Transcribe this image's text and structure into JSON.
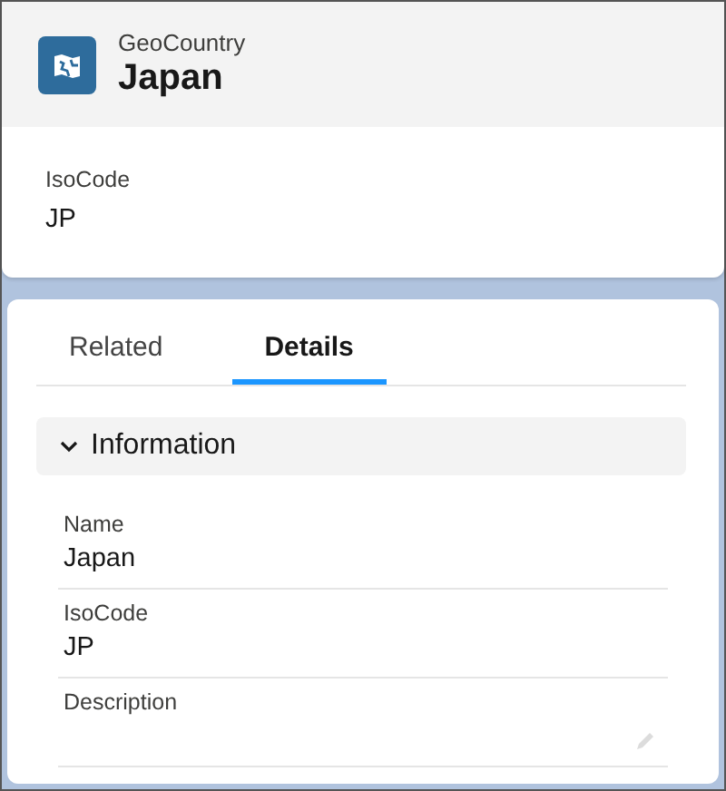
{
  "header": {
    "object_type": "GeoCountry",
    "title": "Japan"
  },
  "highlights": [
    {
      "label": "IsoCode",
      "value": "JP"
    }
  ],
  "tabs": [
    {
      "label": "Related",
      "selected": false
    },
    {
      "label": "Details",
      "selected": true
    }
  ],
  "section": {
    "title": "Information",
    "expanded": true,
    "fields": [
      {
        "label": "Name",
        "value": "Japan",
        "editable": false
      },
      {
        "label": "IsoCode",
        "value": "JP",
        "editable": false
      },
      {
        "label": "Description",
        "editable": true
      }
    ]
  }
}
